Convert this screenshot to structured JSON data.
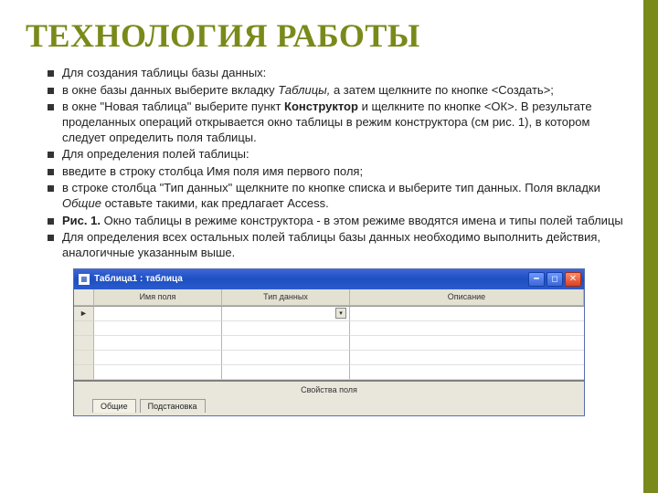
{
  "title": "ТЕХНОЛОГИЯ РАБОТЫ",
  "bullets": {
    "b1": "Для создания таблицы базы данных:",
    "b2_pre": "в окне базы данных выберите вкладку ",
    "b2_it": "Таблицы,",
    "b2_post": " а затем щелкните по кнопке <Создать>;",
    "b3_pre": "в окне \"Новая таблица\" выберите пункт ",
    "b3_bold": "Конструктор",
    "b3_post": " и щелкните по кнопке <ОК>. В результате проделанных операций открывается окно таблицы в режим конструктора (см рис. 1), в котором следует определить поля таблицы.",
    "b4": "Для определения полей таблицы:",
    "b5": "введите в строку столбца Имя поля имя первого поля;",
    "b6_pre": "в строке столбца \"Тип данных\" щелкните по кнопке списка и выберите тип данных. Поля вкладки ",
    "b6_it": "Общие",
    "b6_post": " оставьте такими, как предлагает Access.",
    "b7_bold": "Рис. 1.",
    "b7_post": " Окно таблицы в режиме конструктора - в этом режиме вводятся имена и типы полей таблицы",
    "b8": "Для определения всех остальных полей таблицы базы данных необходимо выполнить действия, аналогичные указанным выше."
  },
  "app": {
    "title": "Таблица1 : таблица",
    "columns": {
      "c1": "Имя поля",
      "c2": "Тип данных",
      "c3": "Описание"
    },
    "section_label": "Свойства поля",
    "tabs": {
      "t1": "Общие",
      "t2": "Подстановка"
    },
    "pointer": "►"
  }
}
